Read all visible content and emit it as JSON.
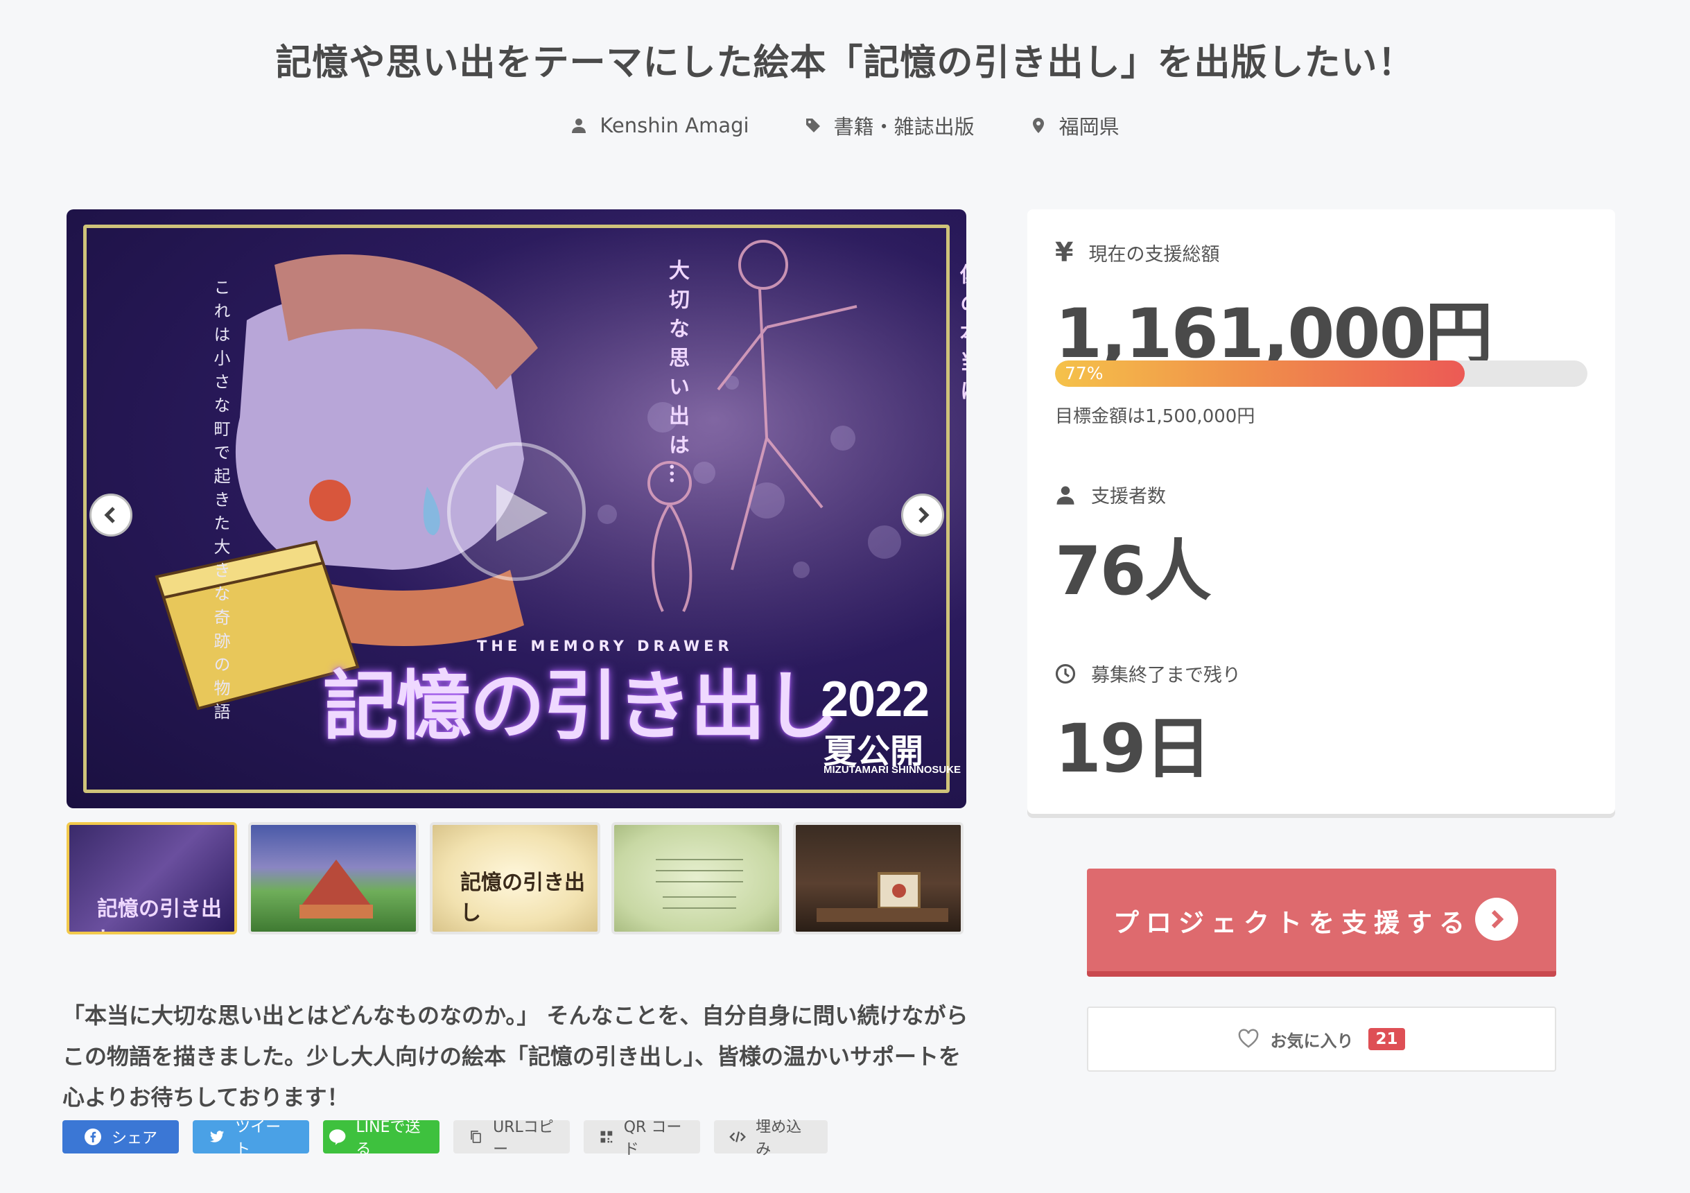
{
  "title": "記憶や思い出をテーマにした絵本「記憶の引き出し」を出版したい！",
  "meta": {
    "owner": "Kenshin Amagi",
    "category": "書籍・雑誌出版",
    "location": "福岡県"
  },
  "hero": {
    "vertical_left": "これは小さな町で起きた大きな奇跡の物語",
    "vertical_center": "大切な思い出は…",
    "vertical_right": "僕の本当に",
    "subtitle_en": "THE MEMORY DRAWER",
    "logo_text": "記憶の引き出し",
    "year": "2022",
    "season": "夏公開",
    "author": "MIZUTAMARI SHINNOSUKE",
    "thumb_logo_text": "記憶の引き出し"
  },
  "thumbnails": [
    {
      "name": "thumbnail-1",
      "active": true
    },
    {
      "name": "thumbnail-2",
      "active": false
    },
    {
      "name": "thumbnail-3",
      "active": false
    },
    {
      "name": "thumbnail-4",
      "active": false
    },
    {
      "name": "thumbnail-5",
      "active": false
    }
  ],
  "description": "「本当に大切な思い出とはどんなものなのか。」 そんなことを、自分自身に問い続けながらこの物語を描きました。少し大人向けの絵本「記憶の引き出し」、皆様の温かいサポートを心よりお待ちしております！",
  "share": {
    "facebook": "シェア",
    "twitter": "ツイート",
    "line": "LINEで送る",
    "url_copy": "URLコピー",
    "qr": "QR コード",
    "embed": "埋め込み"
  },
  "stats": {
    "amount_label": "現在の支援総額",
    "amount": "1,161,000円",
    "progress_percent": 77,
    "progress_text": "77%",
    "goal_text": "目標金額は1,500,000円",
    "supporters_label": "支援者数",
    "supporters": "76人",
    "remaining_label": "募集終了まで残り",
    "remaining": "19日"
  },
  "actions": {
    "support_label": "プロジェクトを支援する",
    "favorite_label": "お気に入り",
    "favorite_count": "21"
  },
  "colors": {
    "support_button": "#de6a6e",
    "progress_start": "#f5c24a",
    "progress_end": "#ec5a55",
    "facebook": "#3b77d5",
    "twitter": "#4aa1e6",
    "line": "#3ec13e"
  }
}
